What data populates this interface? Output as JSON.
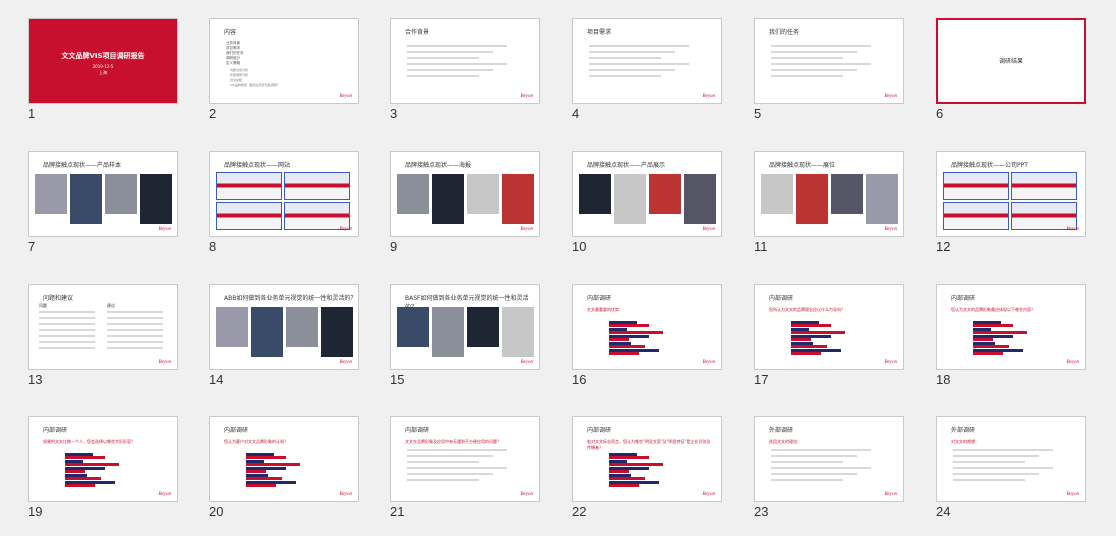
{
  "slides": [
    {
      "n": "1",
      "title": "文文品牌VIS项目调研报告",
      "sub": "2019-12-5",
      "sub2": "上海",
      "kind": "cover"
    },
    {
      "n": "2",
      "title": "内容",
      "kind": "toc",
      "items": [
        "业务背景",
        "项目需求",
        "我们的任务",
        "调研部分",
        "定义策略"
      ],
      "subitems": [
        "内部访谈分析",
        "外部调研分析",
        "访谈总结",
        "VIS品牌规划（结合业务定位和调研）"
      ]
    },
    {
      "n": "3",
      "title": "合作背景",
      "kind": "text"
    },
    {
      "n": "4",
      "title": "项目需求",
      "kind": "text"
    },
    {
      "n": "5",
      "title": "我们的任务",
      "kind": "text"
    },
    {
      "n": "6",
      "title": "调研结果",
      "kind": "section"
    },
    {
      "n": "7",
      "title": "品牌接触点现状——产品样本",
      "kind": "photos"
    },
    {
      "n": "8",
      "title": "品牌接触点现状——网站",
      "kind": "web"
    },
    {
      "n": "9",
      "title": "品牌接触点现状——海报",
      "kind": "photos"
    },
    {
      "n": "10",
      "title": "品牌接触点现状——产品展示",
      "kind": "photos"
    },
    {
      "n": "11",
      "title": "品牌接触点现状——展位",
      "kind": "photos"
    },
    {
      "n": "12",
      "title": "品牌接触点现状——公司PPT",
      "kind": "web"
    },
    {
      "n": "13",
      "title": "问题和建议",
      "kind": "twocol",
      "left": "问题",
      "right": "建议"
    },
    {
      "n": "14",
      "title": "ABB如何做到各业务单元视觉的统一性和灵活的？",
      "kind": "photos"
    },
    {
      "n": "15",
      "title": "BASF如何做到各业务单元视觉的统一性和灵活的？",
      "kind": "photos"
    },
    {
      "n": "16",
      "title": "内部调研",
      "q": "文文最重要的优势：",
      "kind": "chart"
    },
    {
      "n": "17",
      "title": "内部调研",
      "q": "您所认为文文的品牌理念应以什么为导向？",
      "kind": "chart"
    },
    {
      "n": "18",
      "title": "内部调研",
      "q": "您认为文文的品牌形象最应体现以下哪些内容？",
      "kind": "chart"
    },
    {
      "n": "19",
      "title": "内部调研",
      "q": "如果把文文比做一个人，您会选择以哪些字形形容？",
      "kind": "chart"
    },
    {
      "n": "20",
      "title": "内部调研",
      "q": "您认为客户对文文品牌形象的认知？",
      "kind": "chart"
    },
    {
      "n": "21",
      "title": "内部调研",
      "q": "文文在品牌形象及应用中有无遇到不方便应用的问题？",
      "kind": "text"
    },
    {
      "n": "22",
      "title": "内部调研",
      "q": "若对文文标志而言，您认为哪些\"明显文案\"及\"明显特征\"是企业识别及传播者？",
      "kind": "chart"
    },
    {
      "n": "23",
      "title": "外部调研",
      "q": "选用文文的理由：",
      "kind": "text"
    },
    {
      "n": "24",
      "title": "外部调研",
      "q": "对文文的期望：",
      "kind": "text"
    }
  ],
  "brand_logo": "Beyon",
  "colors": {
    "accent": "#c8102e",
    "navy": "#1f2a6b"
  }
}
